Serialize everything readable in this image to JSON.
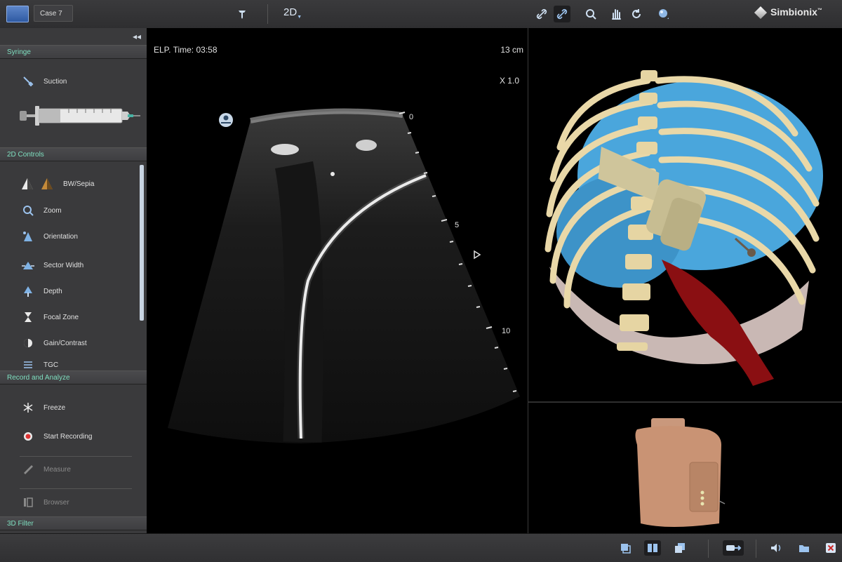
{
  "topbar": {
    "case_label": "Case 7",
    "mode_label": "2D",
    "brand": "Simbionix",
    "brand_mark": "™"
  },
  "sidebar": {
    "collapse_glyph": "◂◂",
    "sections": {
      "syringe": "Syringe",
      "controls_2d": "2D Controls",
      "record": "Record and Analyze",
      "filter_3d": "3D Filter"
    },
    "syringe_items": [
      {
        "label": "Suction",
        "icon": "syringe-icon"
      }
    ],
    "control_items": [
      {
        "label": "BW/Sepia",
        "icon": "bw-sepia-icon"
      },
      {
        "label": "Zoom",
        "icon": "zoom-icon"
      },
      {
        "label": "Orientation",
        "icon": "orientation-icon"
      },
      {
        "label": "Sector Width",
        "icon": "sector-width-icon"
      },
      {
        "label": "Depth",
        "icon": "depth-icon"
      },
      {
        "label": "Focal Zone",
        "icon": "focal-zone-icon"
      },
      {
        "label": "Gain/Contrast",
        "icon": "gain-contrast-icon"
      },
      {
        "label": "TGC",
        "icon": "tgc-icon"
      }
    ],
    "record_items": [
      {
        "label": "Freeze",
        "icon": "snowflake-icon"
      },
      {
        "label": "Start Recording",
        "icon": "record-icon"
      },
      {
        "label": "Measure",
        "icon": "ruler-icon"
      },
      {
        "label": "Browser",
        "icon": "browser-icon"
      }
    ]
  },
  "ultrasound": {
    "elapsed": "ELP. Time: 03:58",
    "depth": "13 cm",
    "zoom": "X 1.0",
    "depth_ticks": [
      "0",
      "5",
      "10"
    ]
  }
}
